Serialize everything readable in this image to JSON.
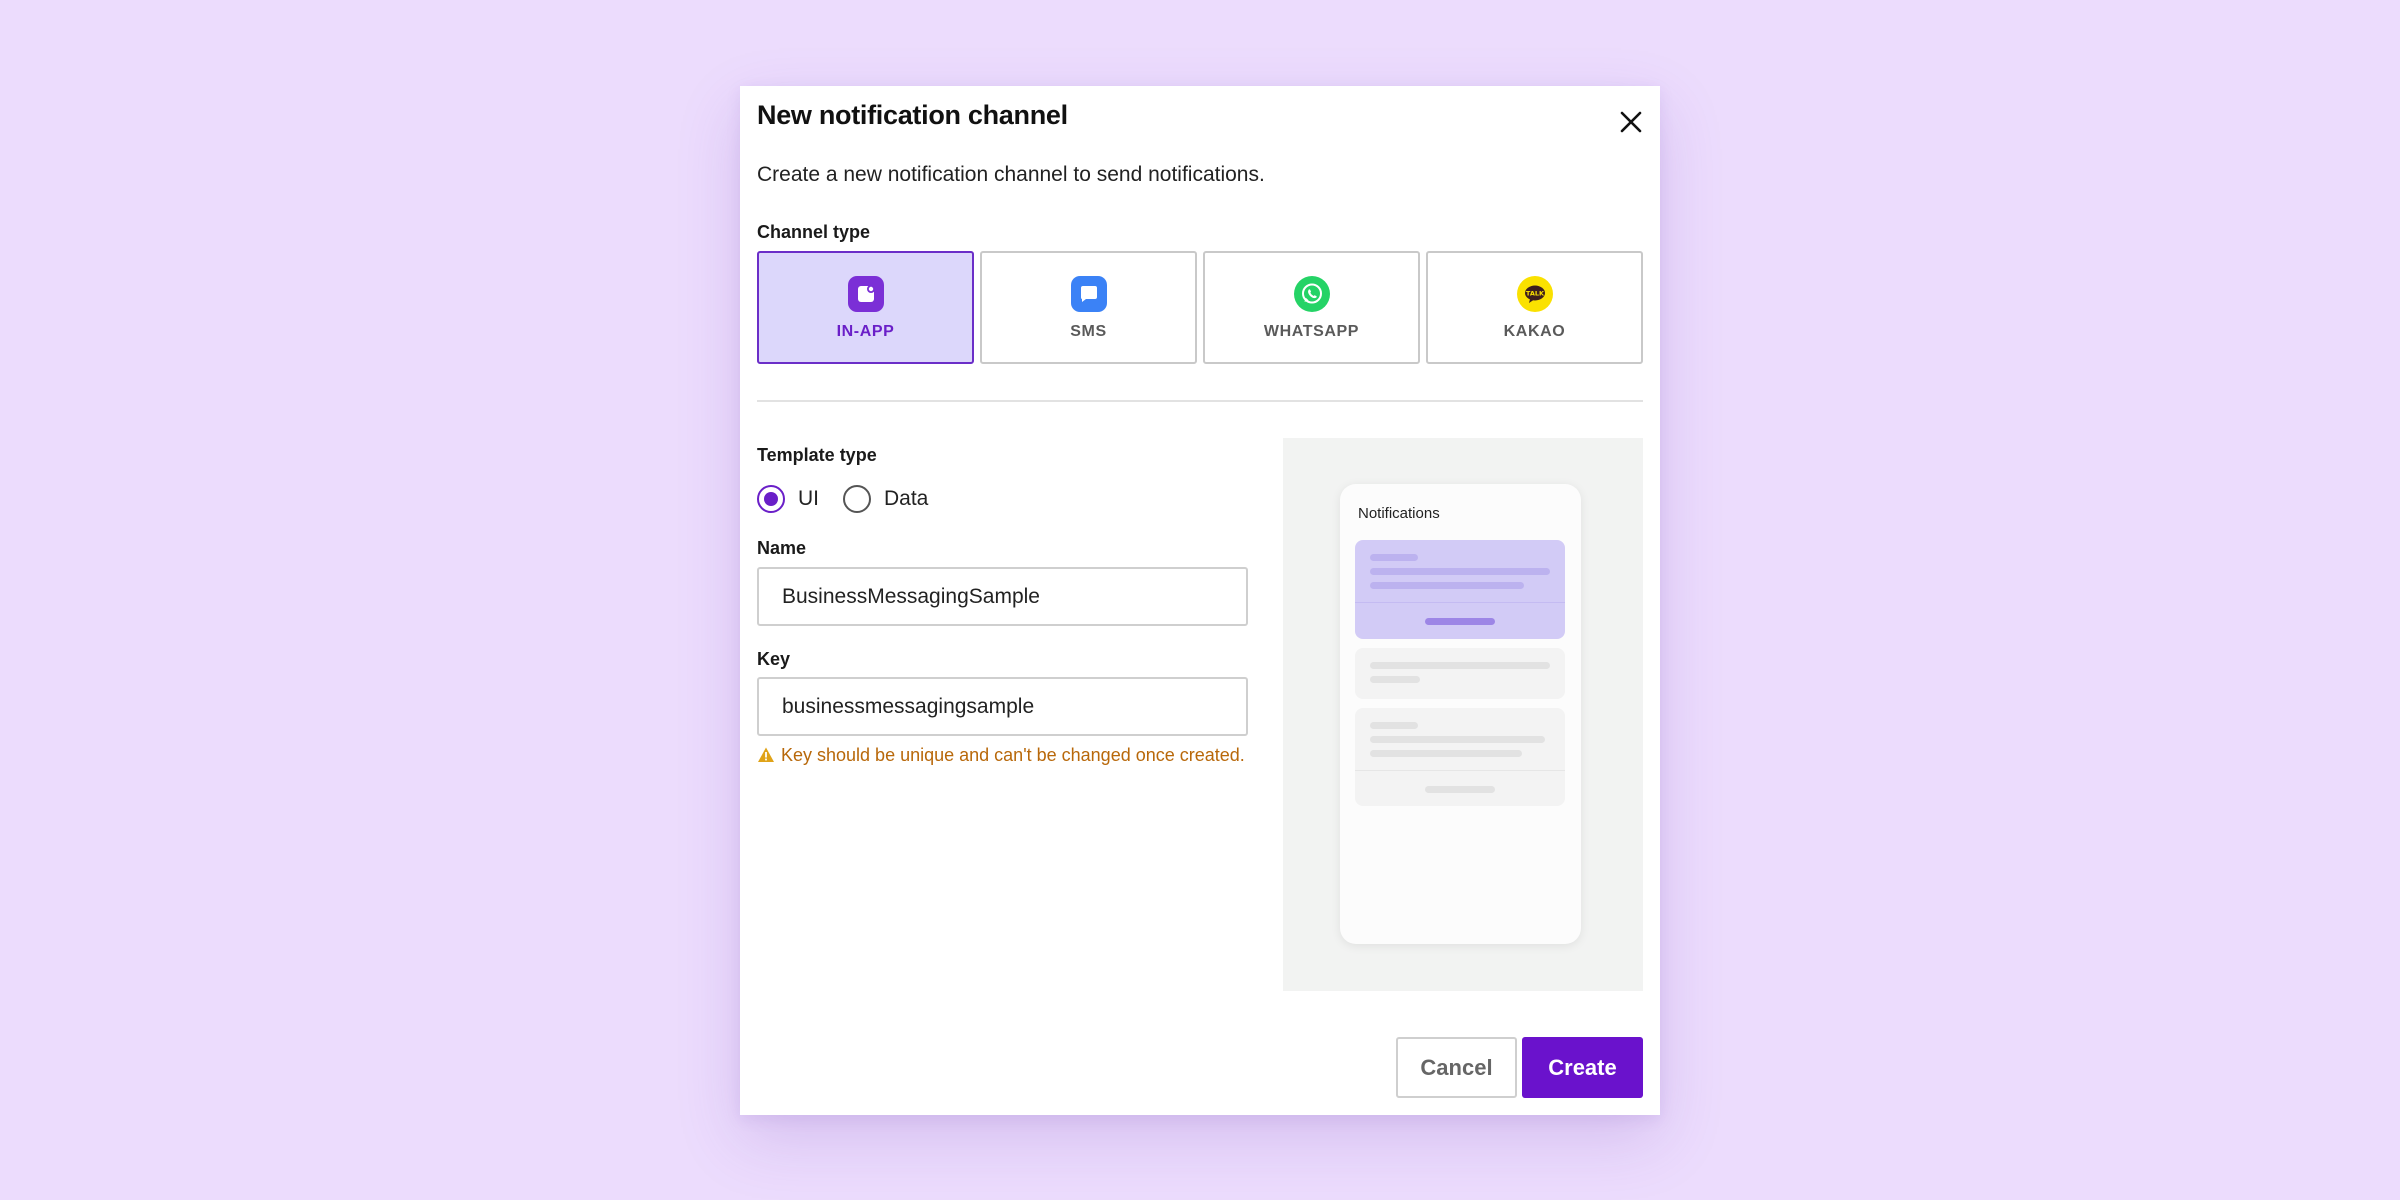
{
  "dialog": {
    "title": "New notification channel",
    "subtitle": "Create a new notification channel to send notifications."
  },
  "channel_type": {
    "label": "Channel type",
    "selected": "IN-APP",
    "options": [
      {
        "label": "IN-APP",
        "icon": "in-app-icon",
        "color": "#7b2fd6"
      },
      {
        "label": "SMS",
        "icon": "sms-icon",
        "color": "#3b82f6"
      },
      {
        "label": "WHATSAPP",
        "icon": "whatsapp-icon",
        "color": "#25d366"
      },
      {
        "label": "KAKAO",
        "icon": "kakao-talk-icon",
        "color": "#fae100"
      }
    ]
  },
  "template_type": {
    "label": "Template type",
    "selected": "UI",
    "options": [
      {
        "label": "UI"
      },
      {
        "label": "Data"
      }
    ]
  },
  "name_field": {
    "label": "Name",
    "value": "BusinessMessagingSample"
  },
  "key_field": {
    "label": "Key",
    "value": "businessmessagingsample",
    "warning": "Key should be unique and can't be changed once created."
  },
  "preview": {
    "title": "Notifications"
  },
  "footer": {
    "cancel_label": "Cancel",
    "create_label": "Create"
  },
  "colors": {
    "background": "#ecdcfd",
    "accent": "#6a12cc",
    "warning": "#b8680a",
    "selected_card_bg": "#dcd7fb"
  }
}
